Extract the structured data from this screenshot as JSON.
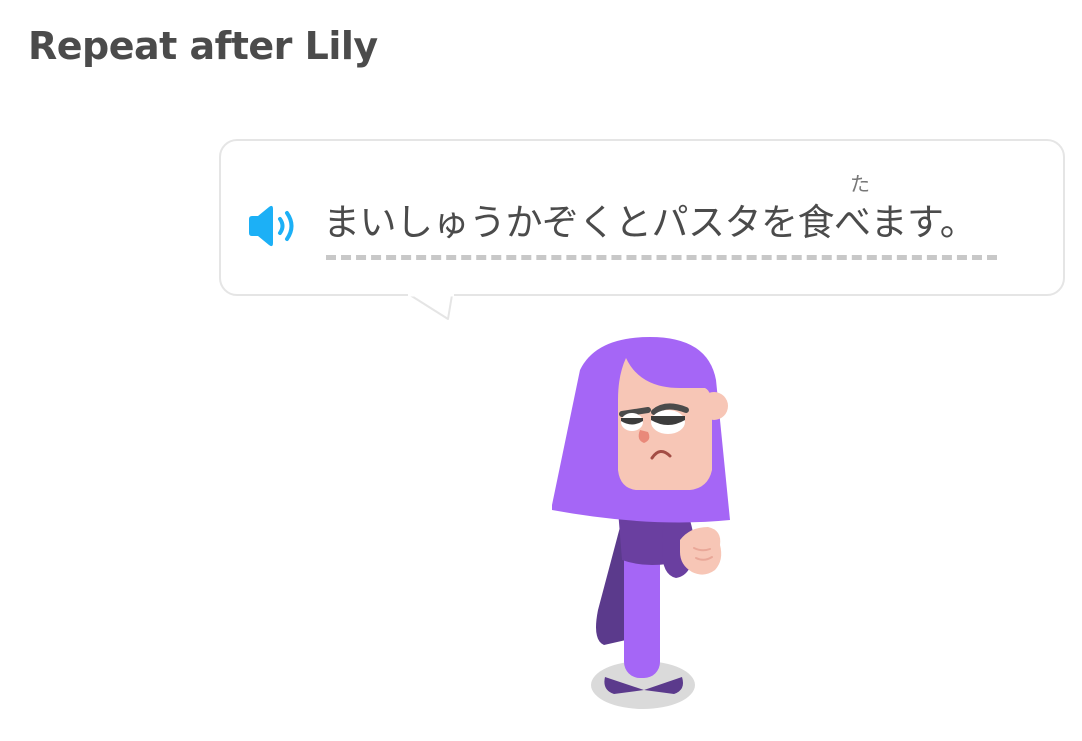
{
  "prompt": {
    "title": "Repeat after Lily"
  },
  "speech_bubble": {
    "speaker_icon": "speaker-icon",
    "sentence": "まいしゅうかぞくとパスタを食べます。",
    "furigana": "た"
  },
  "character": {
    "name": "Lily"
  },
  "colors": {
    "title_text": "#4b4b4b",
    "bubble_border": "#e5e5e5",
    "speaker_blue": "#1cb0f6",
    "underline": "#c8c8c8",
    "hair_purple": "#a566f6",
    "shirt_purple": "#6a3fa0",
    "skin": "#f7c6b6"
  }
}
